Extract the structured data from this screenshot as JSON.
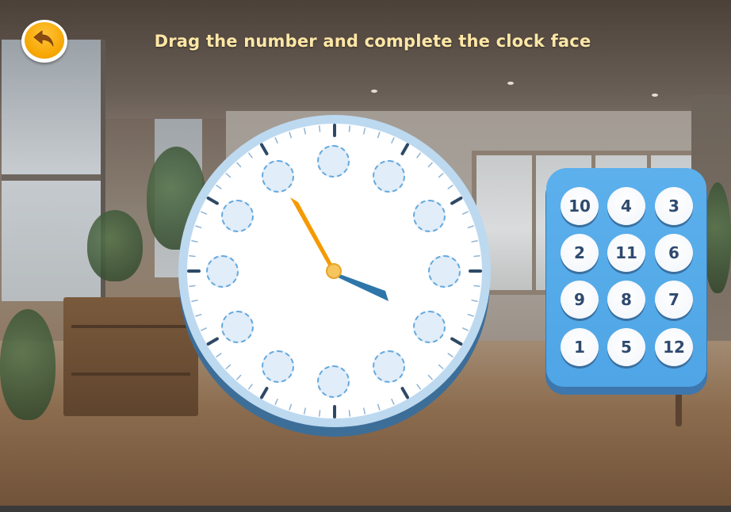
{
  "header": {
    "title": "Drag the number and complete the clock face",
    "back_icon": "undo-arrow-icon"
  },
  "clock": {
    "hour_hand_color": "#2e76aa",
    "minute_hand_color": "#f49a00",
    "empty_slots": 12
  },
  "number_panel": {
    "tiles": [
      "10",
      "4",
      "3",
      "2",
      "11",
      "6",
      "9",
      "8",
      "7",
      "1",
      "5",
      "12"
    ]
  },
  "colors": {
    "title": "#ffe7a6",
    "panel": "#4fa5e5",
    "clock_rim": "#bcd9f0",
    "tile_text": "#2f4a6e",
    "back_button": "#f6a500"
  }
}
